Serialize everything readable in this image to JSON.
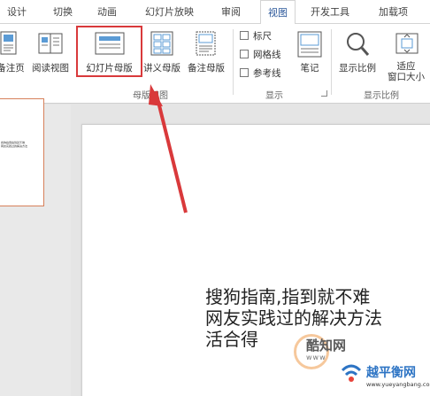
{
  "tabs": [
    {
      "label": "设计",
      "active": false
    },
    {
      "label": "切换",
      "active": false
    },
    {
      "label": "动画",
      "active": false
    },
    {
      "label": "幻灯片放映",
      "active": false
    },
    {
      "label": "审阅",
      "active": false
    },
    {
      "label": "视图",
      "active": true
    },
    {
      "label": "开发工具",
      "active": false
    },
    {
      "label": "加载项",
      "active": false
    }
  ],
  "ribbon": {
    "buttons": {
      "notes_page": "备注页",
      "reading_view": "阅读视图",
      "slide_master": "幻灯片母版",
      "handout_master": "讲义母版",
      "notes_master": "备注母版",
      "notes": "笔记",
      "zoom": "显示比例",
      "fit_window": "适应\n窗口大小"
    },
    "checkboxes": [
      {
        "label": "标尺",
        "checked": false
      },
      {
        "label": "网格线",
        "checked": false
      },
      {
        "label": "参考线",
        "checked": false
      }
    ],
    "groups": {
      "master_views": "母版视图",
      "show": "显示",
      "zoom": "显示比例"
    }
  },
  "highlight_color": "#d9393b",
  "slide": {
    "text": "搜狗指南,指到就不难\n网友实践过的解决方法\n活合得"
  },
  "thumbnail": {
    "text": "搜狗指南指到就不难\n网友实践过的解决方法"
  },
  "watermarks": {
    "cool_know": {
      "text": "酷知网",
      "sub": "www"
    },
    "brand": {
      "text": "越平衡网",
      "url": "www.yueyangbang.com"
    }
  }
}
